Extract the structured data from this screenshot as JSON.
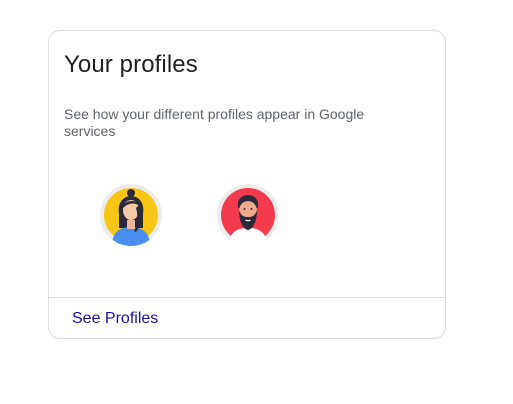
{
  "card": {
    "title": "Your profiles",
    "subtitle": "See how your different profiles appear in Google services",
    "link_label": "See Profiles"
  },
  "profiles": [
    {
      "icon": "profile-avatar-woman-icon",
      "bg_color": "#f9c615"
    },
    {
      "icon": "profile-avatar-man-beard-icon",
      "bg_color": "#f43b4e"
    }
  ],
  "colors": {
    "link": "#1a0dab",
    "border": "#dadce0",
    "subtitle": "#5f6368"
  }
}
